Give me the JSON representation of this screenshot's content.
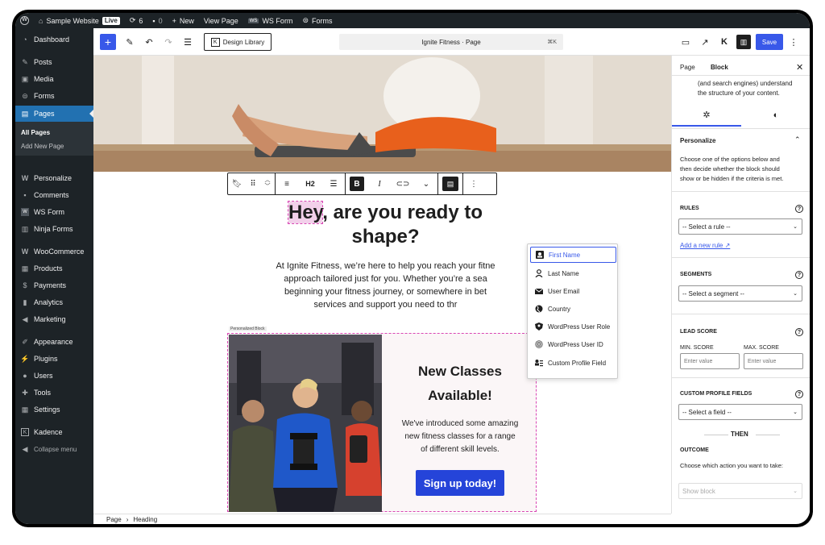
{
  "adminbar": {
    "site_name": "Sample Website",
    "live_badge": "Live",
    "updates_count": "6",
    "comments_count": "0",
    "new_label": "New",
    "view_page_label": "View Page",
    "ws_form_label": "WS Form",
    "forms_label": "Forms"
  },
  "sidebar": {
    "items": [
      {
        "label": "Dashboard",
        "icon": "dashboard-icon"
      },
      {
        "label": "Posts",
        "icon": "pin-icon"
      },
      {
        "label": "Media",
        "icon": "media-icon"
      },
      {
        "label": "Forms",
        "icon": "forms-icon"
      },
      {
        "label": "Pages",
        "icon": "pages-icon"
      },
      {
        "label": "Personalize",
        "icon": "personalize-icon"
      },
      {
        "label": "Comments",
        "icon": "comment-icon"
      },
      {
        "label": "WS Form",
        "icon": "ws-form-icon"
      },
      {
        "label": "Ninja Forms",
        "icon": "ninja-forms-icon"
      },
      {
        "label": "WooCommerce",
        "icon": "woocommerce-icon"
      },
      {
        "label": "Products",
        "icon": "products-icon"
      },
      {
        "label": "Payments",
        "icon": "payments-icon"
      },
      {
        "label": "Analytics",
        "icon": "analytics-icon"
      },
      {
        "label": "Marketing",
        "icon": "marketing-icon"
      },
      {
        "label": "Appearance",
        "icon": "appearance-icon"
      },
      {
        "label": "Plugins",
        "icon": "plugins-icon"
      },
      {
        "label": "Users",
        "icon": "users-icon"
      },
      {
        "label": "Tools",
        "icon": "tools-icon"
      },
      {
        "label": "Settings",
        "icon": "settings-icon"
      },
      {
        "label": "Kadence",
        "icon": "kadence-icon"
      },
      {
        "label": "Collapse menu",
        "icon": "collapse-icon"
      }
    ],
    "submenu": {
      "all_pages": "All Pages",
      "add_new_page": "Add New Page"
    }
  },
  "toolbar": {
    "design_library": "Design Library",
    "doc_title": "Ignite Fitness · Page",
    "shortcut": "⌘K",
    "save": "Save"
  },
  "block_toolbar": {
    "heading_level": "H2"
  },
  "content": {
    "heading_highlight": "Hey",
    "heading_rest_1": ", are you ready to",
    "heading_line2": "shape?",
    "body_lines": [
      "At Ignite Fitness, we’re here to help you reach your fitne",
      "approach tailored just for you. Whether you’re a sea",
      "beginning your fitness journey, or somewhere in bet",
      "services and support you need to thr"
    ],
    "personalized_label": "Personalized Block",
    "class_title_1": "New Classes",
    "class_title_2": "Available!",
    "class_text_lines": [
      "We've introduced some amazing",
      "new fitness classes for a range",
      "of different skill levels."
    ],
    "signup_label": "Sign up today!"
  },
  "dropdown": {
    "items": [
      {
        "label": "First Name",
        "icon": "user-card-icon",
        "selected": true
      },
      {
        "label": "Last Name",
        "icon": "user-icon",
        "selected": false
      },
      {
        "label": "User Email",
        "icon": "email-icon",
        "selected": false
      },
      {
        "label": "Country",
        "icon": "globe-icon",
        "selected": false
      },
      {
        "label": "WordPress User Role",
        "icon": "user-shield-icon",
        "selected": false
      },
      {
        "label": "WordPress User ID",
        "icon": "fingerprint-icon",
        "selected": false
      },
      {
        "label": "Custom Profile Field",
        "icon": "profile-list-icon",
        "selected": false
      }
    ]
  },
  "panel": {
    "tab_page": "Page",
    "tab_block": "Block",
    "desc_line1": "(and search engines) understand",
    "desc_line2": "the structure of your content.",
    "section_title": "Personalize",
    "intro_lines": [
      "Choose one of the options below and",
      "then decide whether the block should",
      "show or be hidden if the criteria is met."
    ],
    "rules_label": "RULES",
    "rules_select": "-- Select a rule --",
    "add_rule": "Add a new rule ↗",
    "segments_label": "SEGMENTS",
    "segments_select": "-- Select a segment --",
    "lead_score_label": "LEAD SCORE",
    "min_score_label": "MIN. SCORE",
    "max_score_label": "MAX. SCORE",
    "min_placeholder": "Enter value",
    "max_placeholder": "Enter value",
    "custom_fields_label": "CUSTOM PROFILE FIELDS",
    "field_select": "-- Select a field --",
    "then_label": "THEN",
    "outcome_label": "OUTCOME",
    "outcome_text": "Choose which action you want to take:",
    "show_block_select": "Show block"
  },
  "breadcrumb": {
    "page": "Page",
    "heading": "Heading"
  },
  "colors": {
    "accent": "#3858e9",
    "admin_dark": "#1d2327",
    "highlight": "#d946b4",
    "signup": "#2544d9"
  }
}
